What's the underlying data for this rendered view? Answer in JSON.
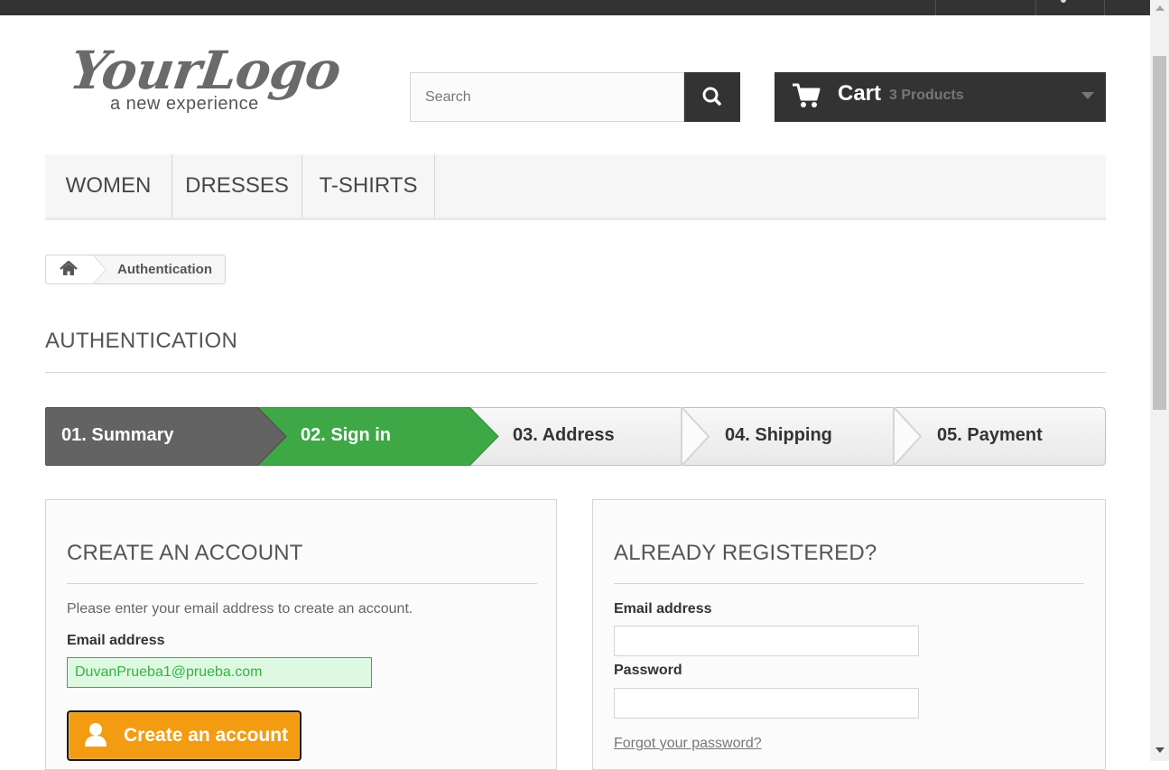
{
  "logo": {
    "script": "YourLogo",
    "tagline": "a new experience"
  },
  "search": {
    "placeholder": "Search"
  },
  "cart": {
    "label": "Cart",
    "count": "3 Products"
  },
  "menu": {
    "items": [
      "WOMEN",
      "DRESSES",
      "T-SHIRTS"
    ]
  },
  "breadcrumb": {
    "current": "Authentication"
  },
  "page": {
    "heading": "AUTHENTICATION"
  },
  "steps": {
    "items": [
      "01. Summary",
      "02. Sign in",
      "03. Address",
      "04. Shipping",
      "05. Payment"
    ],
    "colors": {
      "done": "#636363",
      "current": "#3ea847",
      "todo": "#f2f2f2"
    }
  },
  "create_account": {
    "title": "CREATE AN ACCOUNT",
    "description": "Please enter your email address to create an account.",
    "email_label": "Email address",
    "email_value": "DuvanPrueba1@prueba.com",
    "button_label": "Create an account"
  },
  "registered": {
    "title": "ALREADY REGISTERED?",
    "email_label": "Email address",
    "password_label": "Password",
    "forgot_label": "Forgot your password?"
  },
  "colors": {
    "dark": "#333333",
    "accent": "#f39c11",
    "success": "#3ea847"
  }
}
